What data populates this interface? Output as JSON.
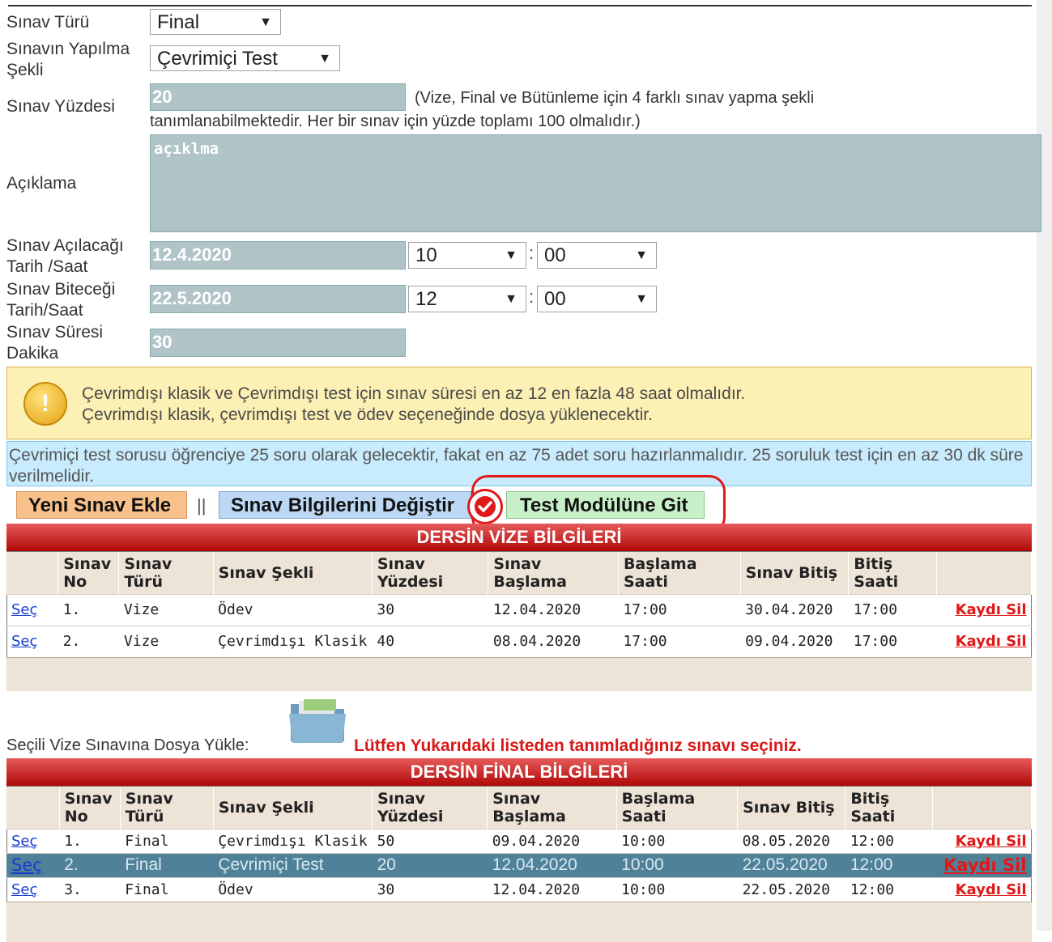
{
  "form": {
    "sinav_turu_label": "Sınav Türü",
    "sinav_turu_value": "Final",
    "yapilma_label_1": "Sınavın Yapılma",
    "yapilma_label_2": "Şekli",
    "yapilma_value": "Çevrimiçi Test",
    "yuzde_label": "Sınav Yüzdesi",
    "yuzde_value": "20",
    "yuzde_note_1": "(Vize, Final ve Bütünleme için 4 farklı sınav yapma şekli",
    "yuzde_note_2": "tanımlanabilmektedir. Her bir sınav için yüzde toplamı 100 olmalıdır.)",
    "aciklama_label": "Açıklama",
    "aciklama_value": "açıklma",
    "acilis_label_1": "Sınav Açılacağı",
    "acilis_label_2": "Tarih /Saat",
    "acilis_date": "12.4.2020",
    "acilis_hour": "10",
    "acilis_min": "00",
    "bitis_label_1": "Sınav Biteceği",
    "bitis_label_2": "Tarih/Saat",
    "bitis_date": "22.5.2020",
    "bitis_hour": "12",
    "bitis_min": "00",
    "sure_label_1": "Sınav Süresi",
    "sure_label_2": "Dakika",
    "sure_value": "30",
    "colon": ":"
  },
  "warning": {
    "line1": "Çevrimdışı klasik ve Çevrimdışı test için sınav süresi en az 12 en fazla 48 saat olmalıdır.",
    "line2": "Çevrimdışı klasik, çevrimdışı test ve ödev seçeneğinde dosya yüklenecektir."
  },
  "info": {
    "text": "Çevrimiçi test sorusu öğrenciye 25 soru olarak gelecektir, fakat en az 75 adet soru hazırlanmalıdır. 25 soruluk test için en az 30 dk süre verilmelidir."
  },
  "buttons": {
    "yeni": "Yeni Sınav Ekle",
    "sep": "||",
    "degistir": "Sınav Bilgilerini Değiştir",
    "test": "Test Modülüne Git"
  },
  "vize": {
    "title": "DERSİN VİZE BİLGİLERİ",
    "headers": [
      "",
      "Sınav No",
      "Sınav Türü",
      "Sınav Şekli",
      "Sınav Yüzdesi",
      "Sınav Başlama",
      "Başlama Saati",
      "Sınav Bitiş",
      "Bitiş Saati",
      ""
    ],
    "rows": [
      {
        "sec": "Seç",
        "no": "1.",
        "tur": "Vize",
        "sekil": "Ödev",
        "yuzde": "30",
        "baslama": "12.04.2020",
        "bsaat": "17:00",
        "bitis": "30.04.2020",
        "bitsaat": "17:00",
        "sil": "Kaydı Sil"
      },
      {
        "sec": "Seç",
        "no": "2.",
        "tur": "Vize",
        "sekil": "Çevrimdışı Klasik",
        "yuzde": "40",
        "baslama": "08.04.2020",
        "bsaat": "17:00",
        "bitis": "09.04.2020",
        "bitsaat": "17:00",
        "sil": "Kaydı Sil"
      }
    ]
  },
  "upload": {
    "label": "Seçili Vize  Sınavına Dosya Yükle:",
    "message": "Lütfen Yukarıdaki listeden tanımladığınız sınavı seçiniz."
  },
  "final": {
    "title": "DERSİN FİNAL BİLGİLERİ",
    "headers": [
      "",
      "Sınav No",
      "Sınav Türü",
      "Sınav Şekli",
      "Sınav Yüzdesi",
      "Sınav Başlama",
      "Başlama Saati",
      "Sınav Bitiş",
      "Bitiş Saati",
      ""
    ],
    "rows": [
      {
        "sec": "Seç",
        "no": "1.",
        "tur": "Final",
        "sekil": "Çevrimdışı Klasik",
        "yuzde": "50",
        "baslama": "09.04.2020",
        "bsaat": "10:00",
        "bitis": "08.05.2020",
        "bitsaat": "12:00",
        "sil": "Kaydı Sil"
      },
      {
        "sec": "Seç",
        "no": "2.",
        "tur": "Final",
        "sekil": "Çevrimiçi Test",
        "yuzde": "20",
        "baslama": "12.04.2020",
        "bsaat": "10:00",
        "bitis": "22.05.2020",
        "bitsaat": "12:00",
        "sil": "Kaydı Sil"
      },
      {
        "sec": "Seç",
        "no": "3.",
        "tur": "Final",
        "sekil": "Ödev",
        "yuzde": "30",
        "baslama": "12.04.2020",
        "bsaat": "10:00",
        "bitis": "22.05.2020",
        "bitsaat": "12:00",
        "sil": "Kaydı Sil"
      }
    ]
  },
  "colors": {
    "header_red": "#c81818",
    "yeni_btn": "#f8c08a",
    "degistir_btn": "#bcd8f4",
    "test_btn": "#c8f0c8",
    "highlight_ring": "#e01818",
    "selected_row": "#4f8299"
  }
}
